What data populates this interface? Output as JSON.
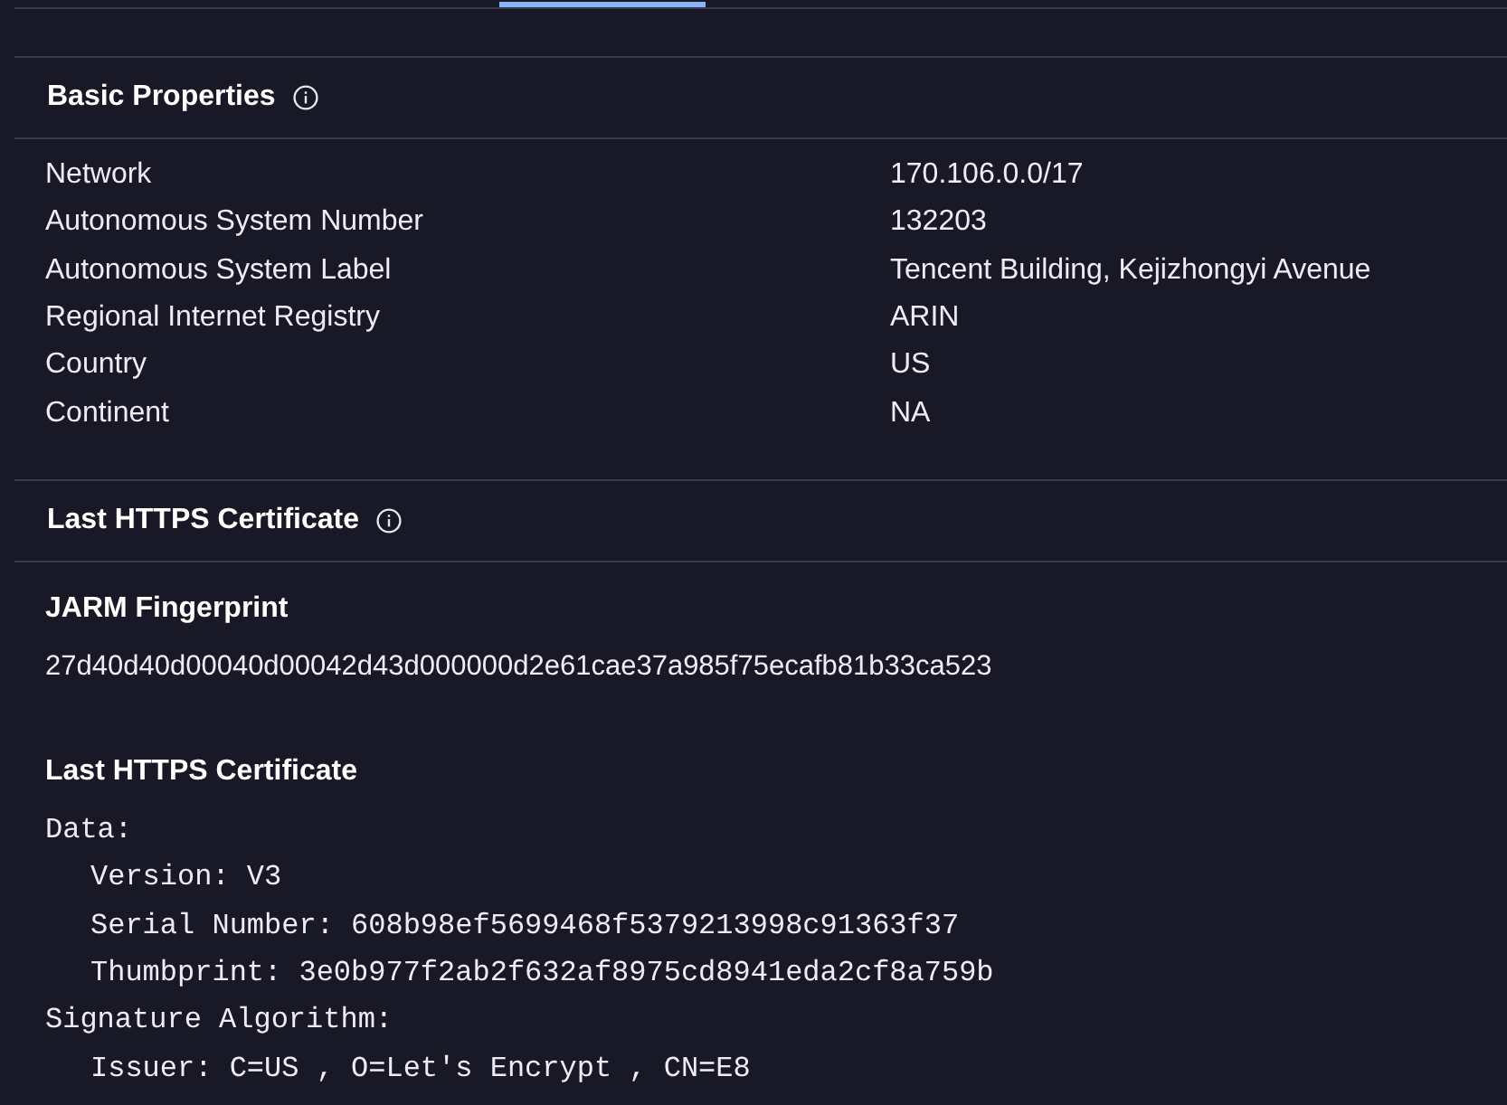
{
  "tab_bar": {
    "active_indicator": true
  },
  "basic_properties": {
    "title": "Basic Properties",
    "rows": [
      {
        "label": "Network",
        "value": "170.106.0.0/17"
      },
      {
        "label": "Autonomous System Number",
        "value": "132203"
      },
      {
        "label": "Autonomous System Label",
        "value": "Tencent Building, Kejizhongyi Avenue"
      },
      {
        "label": "Regional Internet Registry",
        "value": "ARIN"
      },
      {
        "label": "Country",
        "value": "US"
      },
      {
        "label": "Continent",
        "value": "NA"
      }
    ]
  },
  "last_https_certificate": {
    "title": "Last HTTPS Certificate",
    "jarm": {
      "heading": "JARM Fingerprint",
      "value": "27d40d40d00040d00042d43d000000d2e61cae37a985f75ecafb81b33ca523"
    },
    "certificate": {
      "heading": "Last HTTPS Certificate",
      "lines": [
        {
          "text": "Data:",
          "children": [
            {
              "text": "Version: V3"
            },
            {
              "text": "Serial Number: 608b98ef5699468f5379213998c91363f37"
            },
            {
              "text": "Thumbprint: 3e0b977f2ab2f632af8975cd8941eda2cf8a759b"
            }
          ]
        },
        {
          "text": "Signature Algorithm:",
          "children": [
            {
              "text": "Issuer: C=US , O=Let's Encrypt , CN=E8"
            }
          ]
        }
      ]
    }
  }
}
